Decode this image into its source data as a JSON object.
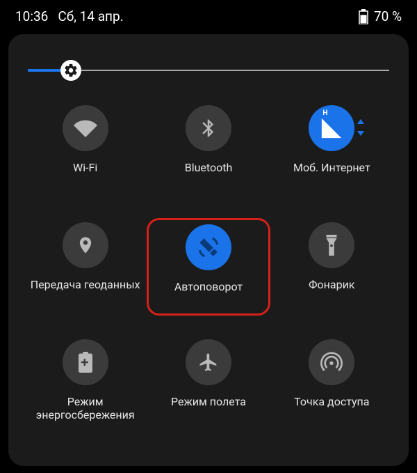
{
  "status": {
    "time": "10:36",
    "date": "Сб, 14 апр.",
    "battery_pct": "70 %"
  },
  "brightness": {
    "value_pct": 12
  },
  "tiles": [
    {
      "id": "wifi",
      "label": "Wi-Fi",
      "on": false,
      "highlight": false
    },
    {
      "id": "bluetooth",
      "label": "Bluetooth",
      "on": false,
      "highlight": false
    },
    {
      "id": "mobiledata",
      "label": "Моб. Интернет",
      "on": true,
      "highlight": false
    },
    {
      "id": "location",
      "label": "Передача геоданных",
      "on": false,
      "highlight": false
    },
    {
      "id": "autorotate",
      "label": "Автоповорот",
      "on": true,
      "highlight": true
    },
    {
      "id": "flashlight",
      "label": "Фонарик",
      "on": false,
      "highlight": false
    },
    {
      "id": "battery",
      "label": "Режим\nэнергосбережения",
      "on": false,
      "highlight": false
    },
    {
      "id": "airplane",
      "label": "Режим полета",
      "on": false,
      "highlight": false
    },
    {
      "id": "hotspot",
      "label": "Точка доступа",
      "on": false,
      "highlight": false
    }
  ],
  "colors": {
    "accent": "#1a73e8",
    "highlight": "#d6201a"
  }
}
